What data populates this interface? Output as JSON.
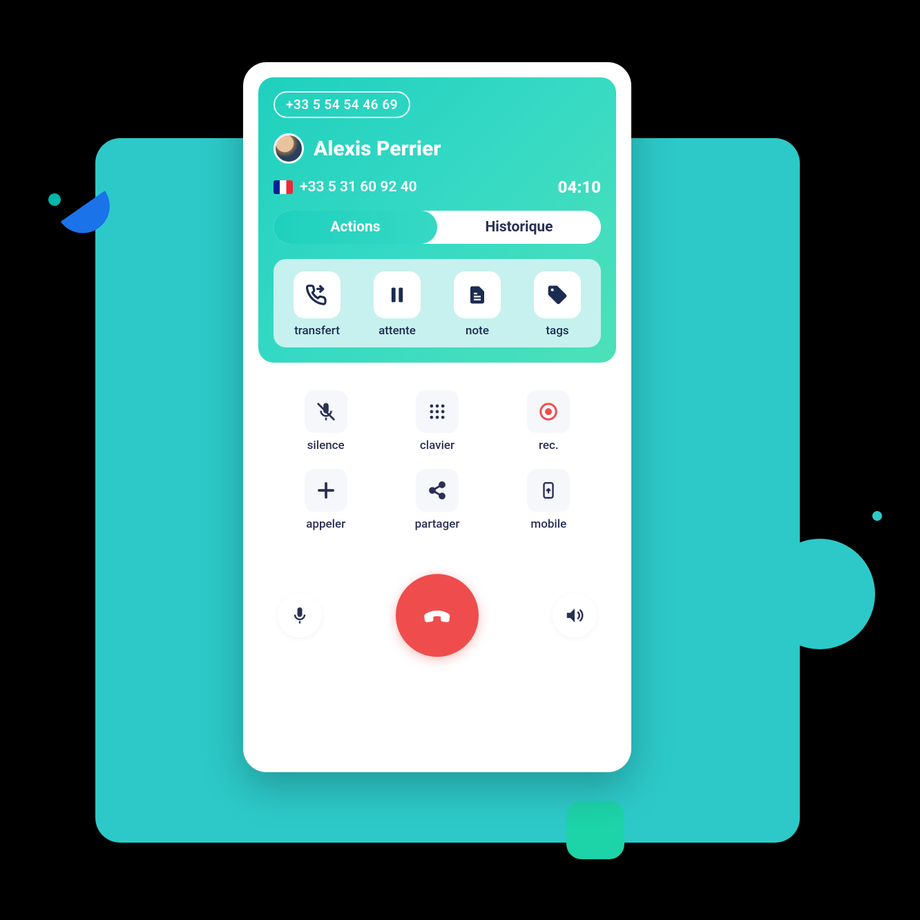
{
  "header": {
    "own_number": "+33 5 54 54 46 69",
    "caller_name": "Alexis Perrier",
    "caller_number": "+33 5 31 60 92 40",
    "call_duration": "04:10"
  },
  "tabs": {
    "actions": "Actions",
    "history": "Historique"
  },
  "actions": {
    "transfer": "transfert",
    "hold": "attente",
    "note": "note",
    "tags": "tags"
  },
  "controls": {
    "mute": "silence",
    "keypad": "clavier",
    "record": "rec.",
    "call": "appeler",
    "share": "partager",
    "mobile": "mobile"
  },
  "colors": {
    "accent": "#2dc9c9",
    "hangup": "#ef4d4d",
    "record": "#ef4d4d"
  }
}
